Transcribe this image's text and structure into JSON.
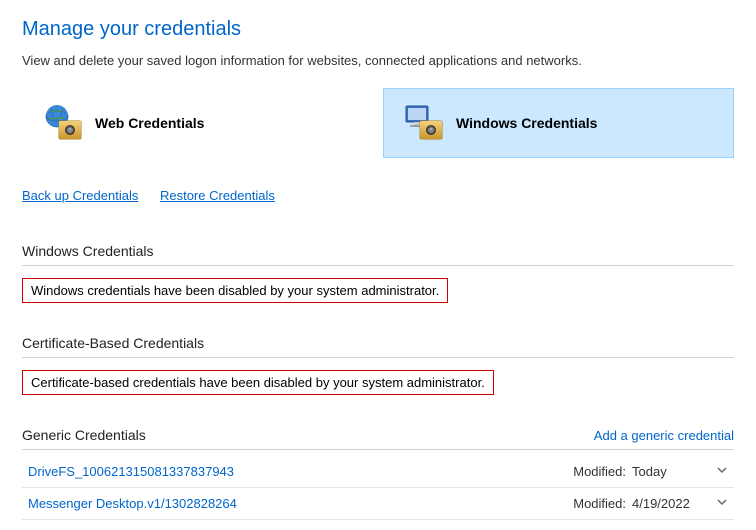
{
  "title": "Manage your credentials",
  "subtitle": "View and delete your saved logon information for websites, connected applications and networks.",
  "tabs": {
    "web": "Web Credentials",
    "windows": "Windows Credentials"
  },
  "links": {
    "backup": "Back up Credentials",
    "restore": "Restore Credentials"
  },
  "sections": {
    "windows": {
      "heading": "Windows Credentials",
      "message": "Windows credentials have been disabled by your system administrator."
    },
    "cert": {
      "heading": "Certificate-Based Credentials",
      "message": "Certificate-based credentials have been disabled by your system administrator."
    },
    "generic": {
      "heading": "Generic Credentials",
      "add_label": "Add a generic credential",
      "modified_label": "Modified:",
      "items": [
        {
          "name": "DriveFS_100621315081337837943",
          "modified": "Today"
        },
        {
          "name": "Messenger Desktop.v1/1302828264",
          "modified": "4/19/2022"
        }
      ]
    }
  }
}
